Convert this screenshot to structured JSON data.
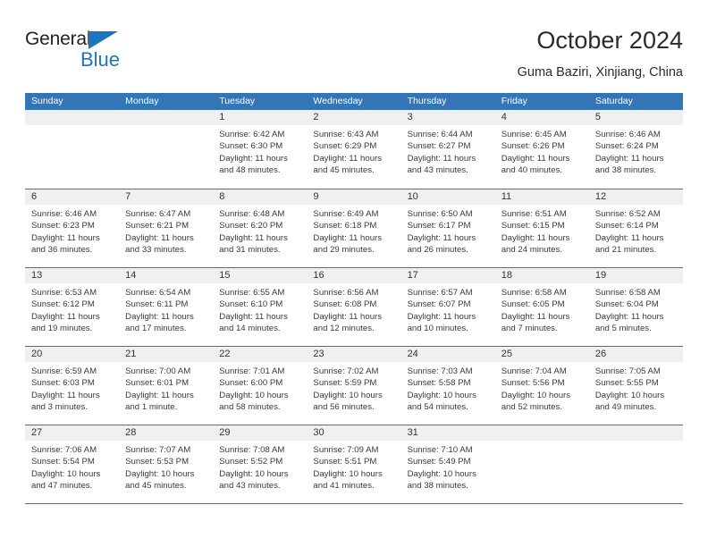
{
  "brand": {
    "name_part1": "General",
    "name_part2": "Blue",
    "triangle_icon": "triangle-icon",
    "color_black": "#231f20",
    "color_blue": "#1d75bc"
  },
  "header": {
    "title": "October 2024",
    "subtitle": "Guma Baziri, Xinjiang, China",
    "accent_color": "#3375b5",
    "day_band_color": "#f0f0f0"
  },
  "weekday_headers": [
    "Sunday",
    "Monday",
    "Tuesday",
    "Wednesday",
    "Thursday",
    "Friday",
    "Saturday"
  ],
  "weeks": [
    [
      {
        "day": "",
        "lines": []
      },
      {
        "day": "",
        "lines": []
      },
      {
        "day": "1",
        "lines": [
          "Sunrise: 6:42 AM",
          "Sunset: 6:30 PM",
          "Daylight: 11 hours",
          "and 48 minutes."
        ]
      },
      {
        "day": "2",
        "lines": [
          "Sunrise: 6:43 AM",
          "Sunset: 6:29 PM",
          "Daylight: 11 hours",
          "and 45 minutes."
        ]
      },
      {
        "day": "3",
        "lines": [
          "Sunrise: 6:44 AM",
          "Sunset: 6:27 PM",
          "Daylight: 11 hours",
          "and 43 minutes."
        ]
      },
      {
        "day": "4",
        "lines": [
          "Sunrise: 6:45 AM",
          "Sunset: 6:26 PM",
          "Daylight: 11 hours",
          "and 40 minutes."
        ]
      },
      {
        "day": "5",
        "lines": [
          "Sunrise: 6:46 AM",
          "Sunset: 6:24 PM",
          "Daylight: 11 hours",
          "and 38 minutes."
        ]
      }
    ],
    [
      {
        "day": "6",
        "lines": [
          "Sunrise: 6:46 AM",
          "Sunset: 6:23 PM",
          "Daylight: 11 hours",
          "and 36 minutes."
        ]
      },
      {
        "day": "7",
        "lines": [
          "Sunrise: 6:47 AM",
          "Sunset: 6:21 PM",
          "Daylight: 11 hours",
          "and 33 minutes."
        ]
      },
      {
        "day": "8",
        "lines": [
          "Sunrise: 6:48 AM",
          "Sunset: 6:20 PM",
          "Daylight: 11 hours",
          "and 31 minutes."
        ]
      },
      {
        "day": "9",
        "lines": [
          "Sunrise: 6:49 AM",
          "Sunset: 6:18 PM",
          "Daylight: 11 hours",
          "and 29 minutes."
        ]
      },
      {
        "day": "10",
        "lines": [
          "Sunrise: 6:50 AM",
          "Sunset: 6:17 PM",
          "Daylight: 11 hours",
          "and 26 minutes."
        ]
      },
      {
        "day": "11",
        "lines": [
          "Sunrise: 6:51 AM",
          "Sunset: 6:15 PM",
          "Daylight: 11 hours",
          "and 24 minutes."
        ]
      },
      {
        "day": "12",
        "lines": [
          "Sunrise: 6:52 AM",
          "Sunset: 6:14 PM",
          "Daylight: 11 hours",
          "and 21 minutes."
        ]
      }
    ],
    [
      {
        "day": "13",
        "lines": [
          "Sunrise: 6:53 AM",
          "Sunset: 6:12 PM",
          "Daylight: 11 hours",
          "and 19 minutes."
        ]
      },
      {
        "day": "14",
        "lines": [
          "Sunrise: 6:54 AM",
          "Sunset: 6:11 PM",
          "Daylight: 11 hours",
          "and 17 minutes."
        ]
      },
      {
        "day": "15",
        "lines": [
          "Sunrise: 6:55 AM",
          "Sunset: 6:10 PM",
          "Daylight: 11 hours",
          "and 14 minutes."
        ]
      },
      {
        "day": "16",
        "lines": [
          "Sunrise: 6:56 AM",
          "Sunset: 6:08 PM",
          "Daylight: 11 hours",
          "and 12 minutes."
        ]
      },
      {
        "day": "17",
        "lines": [
          "Sunrise: 6:57 AM",
          "Sunset: 6:07 PM",
          "Daylight: 11 hours",
          "and 10 minutes."
        ]
      },
      {
        "day": "18",
        "lines": [
          "Sunrise: 6:58 AM",
          "Sunset: 6:05 PM",
          "Daylight: 11 hours",
          "and 7 minutes."
        ]
      },
      {
        "day": "19",
        "lines": [
          "Sunrise: 6:58 AM",
          "Sunset: 6:04 PM",
          "Daylight: 11 hours",
          "and 5 minutes."
        ]
      }
    ],
    [
      {
        "day": "20",
        "lines": [
          "Sunrise: 6:59 AM",
          "Sunset: 6:03 PM",
          "Daylight: 11 hours",
          "and 3 minutes."
        ]
      },
      {
        "day": "21",
        "lines": [
          "Sunrise: 7:00 AM",
          "Sunset: 6:01 PM",
          "Daylight: 11 hours",
          "and 1 minute."
        ]
      },
      {
        "day": "22",
        "lines": [
          "Sunrise: 7:01 AM",
          "Sunset: 6:00 PM",
          "Daylight: 10 hours",
          "and 58 minutes."
        ]
      },
      {
        "day": "23",
        "lines": [
          "Sunrise: 7:02 AM",
          "Sunset: 5:59 PM",
          "Daylight: 10 hours",
          "and 56 minutes."
        ]
      },
      {
        "day": "24",
        "lines": [
          "Sunrise: 7:03 AM",
          "Sunset: 5:58 PM",
          "Daylight: 10 hours",
          "and 54 minutes."
        ]
      },
      {
        "day": "25",
        "lines": [
          "Sunrise: 7:04 AM",
          "Sunset: 5:56 PM",
          "Daylight: 10 hours",
          "and 52 minutes."
        ]
      },
      {
        "day": "26",
        "lines": [
          "Sunrise: 7:05 AM",
          "Sunset: 5:55 PM",
          "Daylight: 10 hours",
          "and 49 minutes."
        ]
      }
    ],
    [
      {
        "day": "27",
        "lines": [
          "Sunrise: 7:06 AM",
          "Sunset: 5:54 PM",
          "Daylight: 10 hours",
          "and 47 minutes."
        ]
      },
      {
        "day": "28",
        "lines": [
          "Sunrise: 7:07 AM",
          "Sunset: 5:53 PM",
          "Daylight: 10 hours",
          "and 45 minutes."
        ]
      },
      {
        "day": "29",
        "lines": [
          "Sunrise: 7:08 AM",
          "Sunset: 5:52 PM",
          "Daylight: 10 hours",
          "and 43 minutes."
        ]
      },
      {
        "day": "30",
        "lines": [
          "Sunrise: 7:09 AM",
          "Sunset: 5:51 PM",
          "Daylight: 10 hours",
          "and 41 minutes."
        ]
      },
      {
        "day": "31",
        "lines": [
          "Sunrise: 7:10 AM",
          "Sunset: 5:49 PM",
          "Daylight: 10 hours",
          "and 38 minutes."
        ]
      },
      {
        "day": "",
        "lines": []
      },
      {
        "day": "",
        "lines": []
      }
    ]
  ]
}
